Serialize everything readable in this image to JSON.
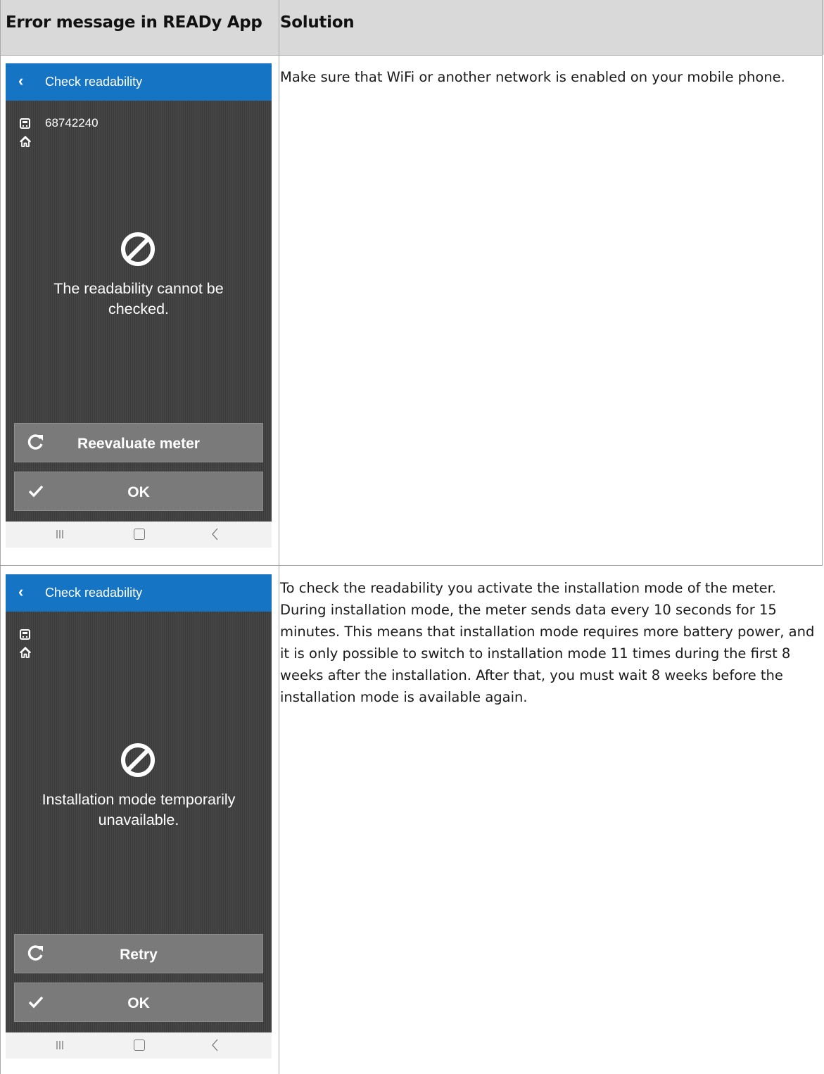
{
  "table": {
    "header": {
      "col1": "Error message in READy App",
      "col2": "Solution"
    },
    "rows": [
      {
        "screen": {
          "title": "Check readability",
          "meter_number": "68742240",
          "message": "The readability cannot be checked.",
          "primary_button": "Reevaluate meter",
          "secondary_button": "OK",
          "icons": [
            "back-icon",
            "meter-icon",
            "home-icon",
            "blocked-icon",
            "refresh-icon",
            "check-icon",
            "nav-recents-icon",
            "nav-home-icon",
            "nav-back-icon"
          ]
        },
        "solution": "Make sure that WiFi or another network is enabled on your mobile phone."
      },
      {
        "screen": {
          "title": "Check readability",
          "meter_number": "",
          "message": "Installation mode temporarily unavailable.",
          "primary_button": "Retry",
          "secondary_button": "OK",
          "icons": [
            "back-icon",
            "meter-icon",
            "home-icon",
            "blocked-icon",
            "refresh-icon",
            "check-icon",
            "nav-recents-icon",
            "nav-home-icon",
            "nav-back-icon"
          ]
        },
        "solution": "To check the readability you activate the installation mode of the meter. During installation mode, the meter sends data every 10 seconds for 15 minutes. This means that installation mode requires more battery power, and it is only possible to switch to installation mode 11 times during the first 8 weeks after the installation. After that, you must wait 8 weeks before the installation mode is available again."
      }
    ]
  },
  "colors": {
    "app_bar": "#1674c4",
    "screen_bg": "#404040",
    "button_bg": "#7a7a7a",
    "header_bg": "#d9d9d9"
  }
}
